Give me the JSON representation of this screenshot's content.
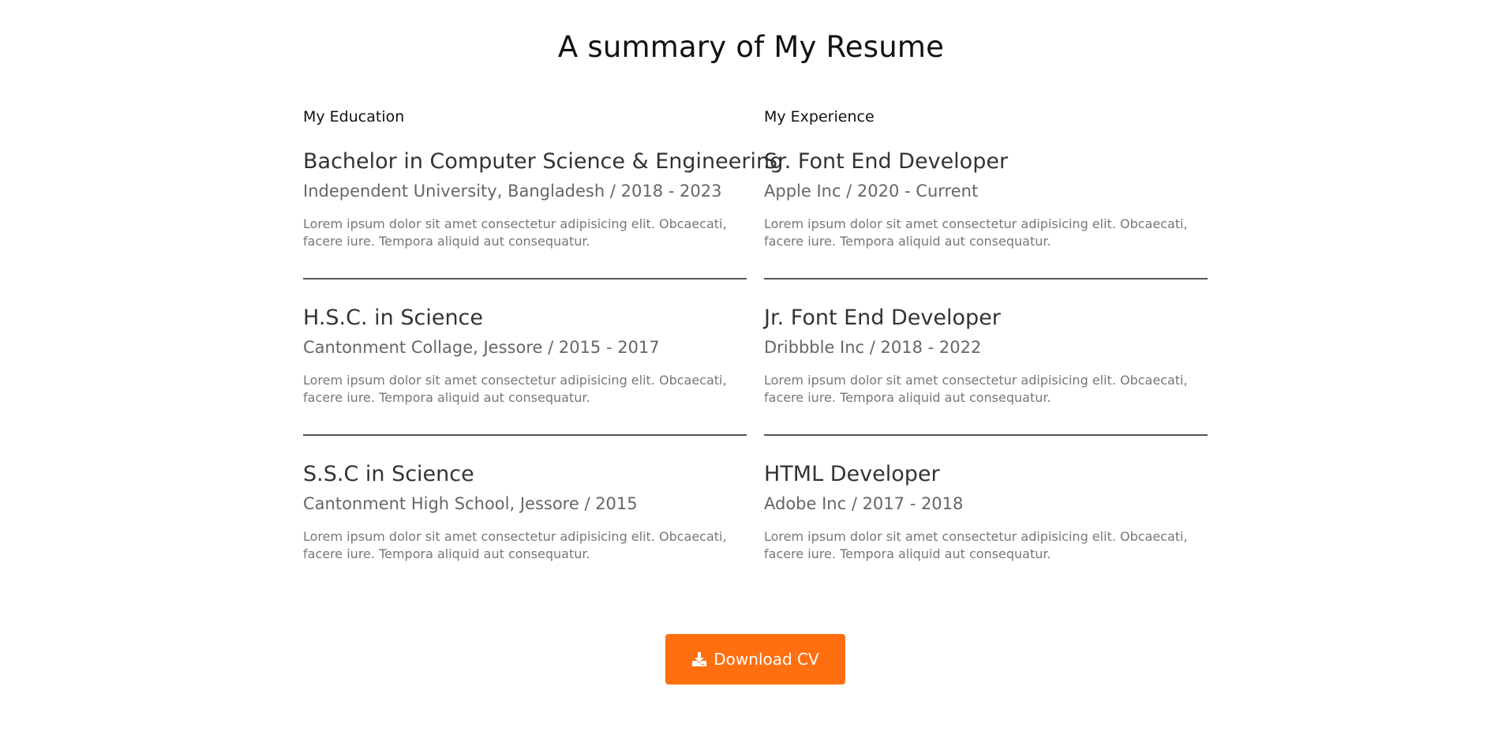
{
  "page": {
    "title": "A summary of My Resume"
  },
  "education": {
    "heading": "My Education",
    "items": [
      {
        "title": "Bachelor in Computer Science & Engineering",
        "subtitle": "Independent University, Bangladesh / 2018 - 2023",
        "description": "Lorem ipsum dolor sit amet consectetur adipisicing elit. Obcaecati, facere iure. Tempora aliquid aut consequatur."
      },
      {
        "title": "H.S.C. in Science",
        "subtitle": "Cantonment Collage, Jessore / 2015 - 2017",
        "description": "Lorem ipsum dolor sit amet consectetur adipisicing elit. Obcaecati, facere iure. Tempora aliquid aut consequatur."
      },
      {
        "title": "S.S.C in Science",
        "subtitle": "Cantonment High School, Jessore / 2015",
        "description": "Lorem ipsum dolor sit amet consectetur adipisicing elit. Obcaecati, facere iure. Tempora aliquid aut consequatur."
      }
    ]
  },
  "experience": {
    "heading": "My Experience",
    "items": [
      {
        "title": "Sr. Font End Developer",
        "subtitle": "Apple Inc / 2020 - Current",
        "description": "Lorem ipsum dolor sit amet consectetur adipisicing elit. Obcaecati, facere iure. Tempora aliquid aut consequatur."
      },
      {
        "title": "Jr. Font End Developer",
        "subtitle": "Dribbble Inc / 2018 - 2022",
        "description": "Lorem ipsum dolor sit amet consectetur adipisicing elit. Obcaecati, facere iure. Tempora aliquid aut consequatur."
      },
      {
        "title": "HTML Developer",
        "subtitle": "Adobe Inc / 2017 - 2018",
        "description": "Lorem ipsum dolor sit amet consectetur adipisicing elit. Obcaecati, facere iure. Tempora aliquid aut consequatur."
      }
    ]
  },
  "download": {
    "label": "Download CV",
    "icon": "download-icon",
    "color": "#ff6f10"
  }
}
